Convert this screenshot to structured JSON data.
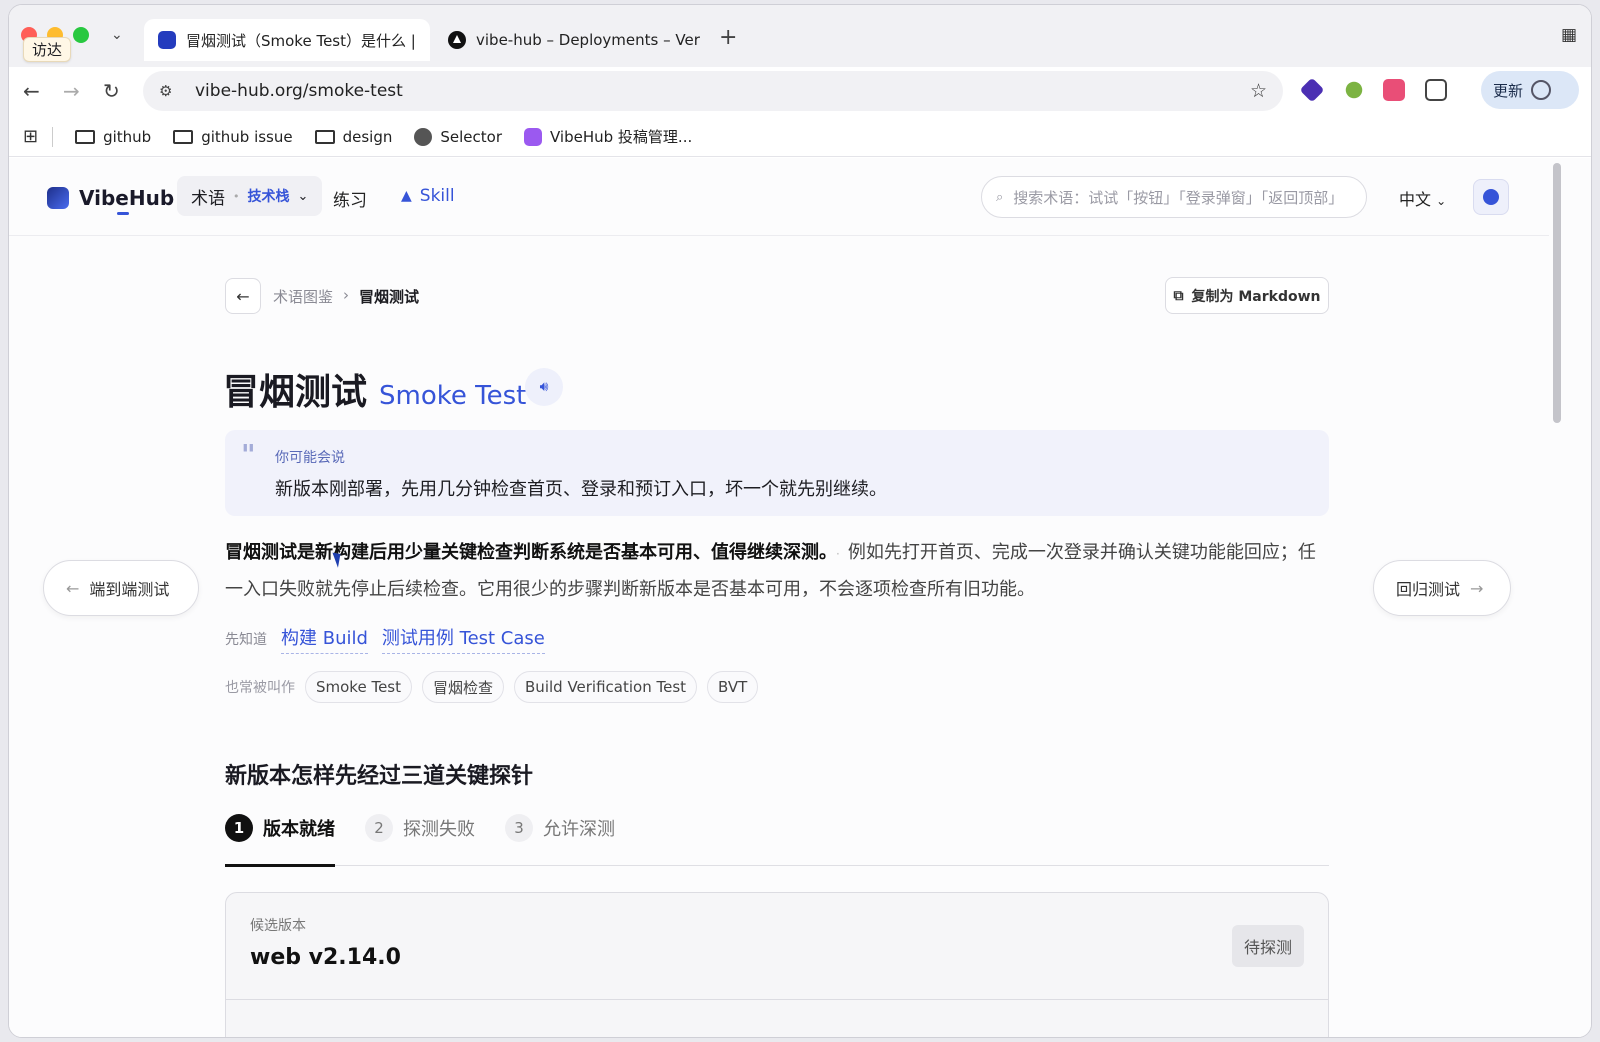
{
  "browser": {
    "finder_label": "访达",
    "tabs": [
      {
        "title": "冒烟测试（Smoke Test）是什么 | 术",
        "active": true
      },
      {
        "title": "vibe-hub – Deployments – Vercel",
        "active": false
      }
    ],
    "new_tab": "+",
    "url": "vibe-hub.org/smoke-test",
    "update_label": "更新",
    "bookmarks": [
      "github",
      "github issue",
      "design",
      "Selector",
      "VibeHub 投稿管理..."
    ]
  },
  "header": {
    "logo": "VibeHub",
    "nav_terms": "术语",
    "nav_terms_sub": "技术栈",
    "nav_practice": "练习",
    "nav_skill": "Skill",
    "search_placeholder": "搜索术语：试试「按钮」「登录弹窗」「返回顶部」",
    "language": "中文"
  },
  "breadcrumb": {
    "parent": "术语图鉴",
    "current": "冒烟测试"
  },
  "copy_button": "复制为 Markdown",
  "term": {
    "title_zh": "冒烟测试",
    "title_en": "Smoke Test"
  },
  "quote": {
    "label": "你可能会说",
    "text": "新版本刚部署，先用几分钟检查首页、登录和预订入口，坏一个就先别继续。"
  },
  "definition": {
    "lead": "冒烟测试是新构建后用少量关键检查判断系统是否基本可用、值得继续深测。",
    "separator": "·",
    "body": "例如先打开首页、完成一次登录并确认关键功能能回应；任一入口失败就先停止后续检查。它用很少的步骤判断新版本是否基本可用，不会逐项检查所有旧功能。"
  },
  "side_nav": {
    "prev": "端到端测试",
    "next": "回归测试"
  },
  "prerequisites": {
    "label": "先知道",
    "items": [
      "构建 Build",
      "测试用例 Test Case"
    ]
  },
  "aliases": {
    "label": "也常被叫作",
    "items": [
      "Smoke Test",
      "冒烟检查",
      "Build Verification Test",
      "BVT"
    ]
  },
  "section": {
    "title": "新版本怎样先经过三道关键探针",
    "steps": [
      {
        "num": "1",
        "label": "版本就绪"
      },
      {
        "num": "2",
        "label": "探测失败"
      },
      {
        "num": "3",
        "label": "允许深测"
      }
    ],
    "active_step": 1
  },
  "card": {
    "label": "候选版本",
    "value": "web v2.14.0",
    "status": "待探测"
  },
  "colors": {
    "accent": "#3654d8",
    "quote_bg": "#f1f2fb"
  }
}
